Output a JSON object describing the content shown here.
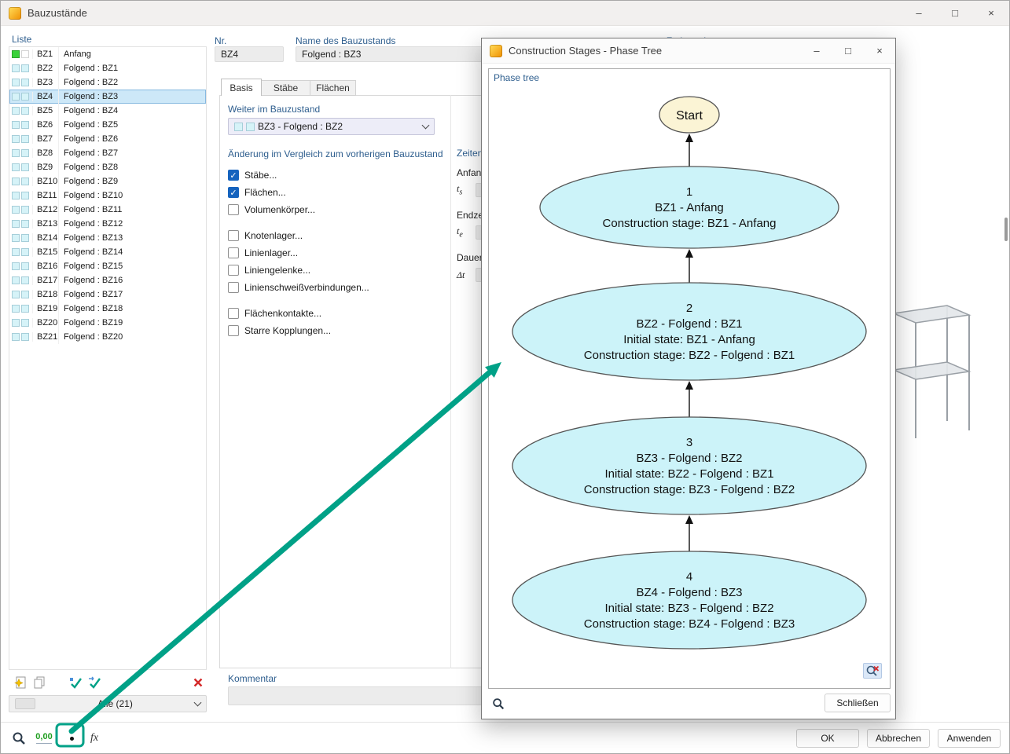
{
  "colors": {
    "accent_teal": "#00A187",
    "label_blue": "#2E5E8E",
    "selection": "#CDE8F8",
    "node_fill": "#CCF3F9",
    "start_fill": "#FBF4D5",
    "check_blue": "#1563BE",
    "swatch_green": "#3BD23B",
    "swatch_cyan": "#D6F3F8",
    "delete_red": "#D42A2A",
    "decimal_green": "#1E9E1E"
  },
  "window": {
    "title": "Bauzustände",
    "minimize": "–",
    "maximize": "□",
    "close": "×"
  },
  "list": {
    "label": "Liste",
    "selected_id": "BZ4",
    "filter_label": "Alle (21)",
    "items": [
      {
        "id": "BZ1",
        "desc": "Anfang",
        "green": true
      },
      {
        "id": "BZ2",
        "desc": "Folgend : BZ1"
      },
      {
        "id": "BZ3",
        "desc": "Folgend : BZ2"
      },
      {
        "id": "BZ4",
        "desc": "Folgend : BZ3"
      },
      {
        "id": "BZ5",
        "desc": "Folgend : BZ4"
      },
      {
        "id": "BZ6",
        "desc": "Folgend : BZ5"
      },
      {
        "id": "BZ7",
        "desc": "Folgend : BZ6"
      },
      {
        "id": "BZ8",
        "desc": "Folgend : BZ7"
      },
      {
        "id": "BZ9",
        "desc": "Folgend : BZ8"
      },
      {
        "id": "BZ10",
        "desc": "Folgend : BZ9"
      },
      {
        "id": "BZ11",
        "desc": "Folgend : BZ10"
      },
      {
        "id": "BZ12",
        "desc": "Folgend : BZ11"
      },
      {
        "id": "BZ13",
        "desc": "Folgend : BZ12"
      },
      {
        "id": "BZ14",
        "desc": "Folgend : BZ13"
      },
      {
        "id": "BZ15",
        "desc": "Folgend : BZ14"
      },
      {
        "id": "BZ16",
        "desc": "Folgend : BZ15"
      },
      {
        "id": "BZ17",
        "desc": "Folgend : BZ16"
      },
      {
        "id": "BZ18",
        "desc": "Folgend : BZ17"
      },
      {
        "id": "BZ19",
        "desc": "Folgend : BZ18"
      },
      {
        "id": "BZ20",
        "desc": "Folgend : BZ19"
      },
      {
        "id": "BZ21",
        "desc": "Folgend : BZ20"
      }
    ]
  },
  "header": {
    "nr_label": "Nr.",
    "nr_value": "BZ4",
    "name_label": "Name des Bauzustands",
    "name_value": "Folgend : BZ3",
    "compute_label": "Zu berechnen"
  },
  "tabs": [
    "Basis",
    "Stäbe",
    "Flächen"
  ],
  "basis": {
    "weiter_label": "Weiter im Bauzustand",
    "weiter_value": "BZ3 - Folgend : BZ2",
    "aenderung_label": "Änderung im Vergleich zum vorherigen Bauzustand",
    "checkbox_groups": [
      [
        {
          "label": "Stäbe...",
          "checked": true
        },
        {
          "label": "Flächen...",
          "checked": true
        },
        {
          "label": "Volumenkörper...",
          "checked": false
        }
      ],
      [
        {
          "label": "Knotenlager...",
          "checked": false
        },
        {
          "label": "Linienlager...",
          "checked": false
        },
        {
          "label": "Liniengelenke...",
          "checked": false
        },
        {
          "label": "Linienschweißverbindungen...",
          "checked": false
        }
      ],
      [
        {
          "label": "Flächenkontakte...",
          "checked": false
        },
        {
          "label": "Starre Kopplungen...",
          "checked": false
        }
      ]
    ],
    "zeiten": {
      "label": "Zeiten",
      "rows": [
        {
          "label": "Anfan",
          "sym": "t",
          "sub": "s"
        },
        {
          "label": "Endze",
          "sym": "t",
          "sub": "e"
        },
        {
          "label": "Dauer",
          "sym": "Δt",
          "sub": ""
        }
      ]
    },
    "kommentar_label": "Kommentar"
  },
  "footer": {
    "decimal_label": "0,00",
    "fx_label": "fx",
    "ok": "OK",
    "cancel": "Abbrechen",
    "apply": "Anwenden"
  },
  "phase_dialog": {
    "title": "Construction Stages - Phase Tree",
    "minimize": "–",
    "maximize": "□",
    "close": "×",
    "tree_label": "Phase tree",
    "start_label": "Start",
    "close_button": "Schließen",
    "nodes": [
      {
        "lines": [
          "1",
          "BZ1 - Anfang",
          "Construction stage: BZ1 - Anfang"
        ]
      },
      {
        "lines": [
          "2",
          "BZ2 - Folgend : BZ1",
          "Initial state: BZ1 - Anfang",
          "Construction stage: BZ2 - Folgend : BZ1"
        ]
      },
      {
        "lines": [
          "3",
          "BZ3 - Folgend : BZ2",
          "Initial state: BZ2 - Folgend : BZ1",
          "Construction stage: BZ3 - Folgend : BZ2"
        ]
      },
      {
        "lines": [
          "4",
          "BZ4 - Folgend : BZ3",
          "Initial state: BZ3 - Folgend : BZ2",
          "Construction stage: BZ4 - Folgend : BZ3"
        ]
      }
    ]
  }
}
